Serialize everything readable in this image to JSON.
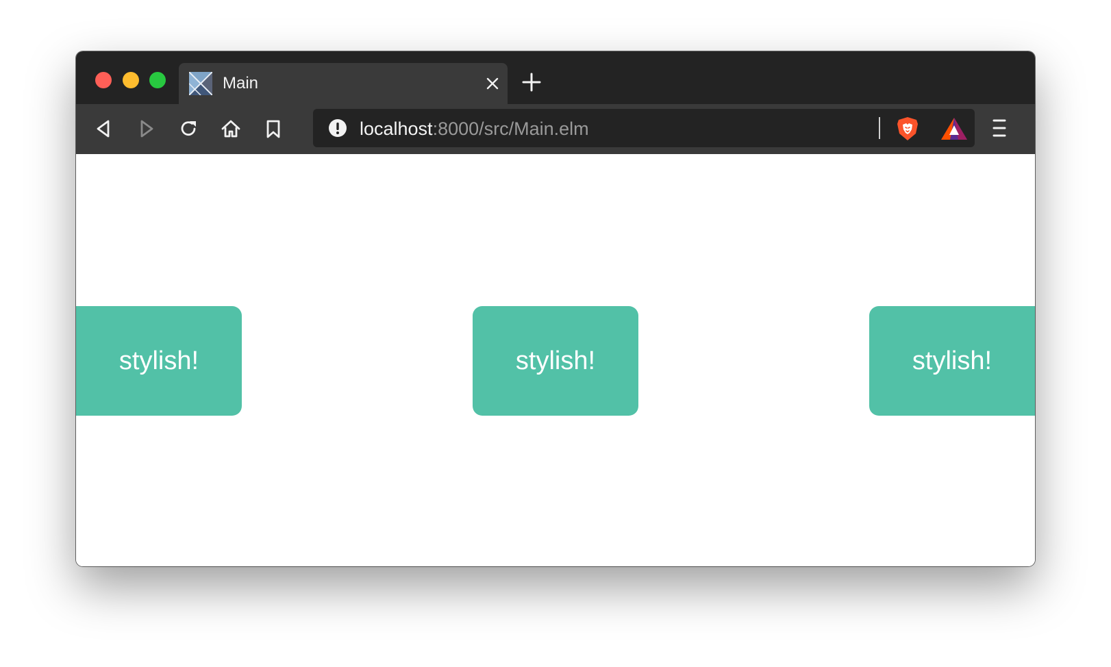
{
  "colors": {
    "titlebar": "#232323",
    "toolbar": "#3a3a3a",
    "urlbar": "#232323",
    "button_bg": "#52c1a7",
    "button_text": "#ffffff",
    "close_dot": "#fe5f57",
    "minimize_dot": "#febc2e",
    "maximize_dot": "#28c840"
  },
  "window": {
    "controls": [
      "close",
      "minimize",
      "maximize"
    ]
  },
  "tab": {
    "title": "Main",
    "favicon": "elm-logo-icon",
    "close_icon": "close-icon"
  },
  "new_tab_icon": "plus-icon",
  "toolbar": {
    "buttons": [
      "back-icon",
      "forward-icon",
      "reload-icon",
      "home-icon",
      "bookmark-icon"
    ]
  },
  "address_bar": {
    "host": "localhost",
    "rest": ":8000/src/Main.elm",
    "info_icon": "info-icon",
    "shield_icon": "brave-shield-icon",
    "rewards_icon": "brave-rewards-icon"
  },
  "menu_icon": "hamburger-menu-icon",
  "page": {
    "buttons": [
      {
        "label": "stylish!"
      },
      {
        "label": "stylish!"
      },
      {
        "label": "stylish!"
      }
    ]
  }
}
